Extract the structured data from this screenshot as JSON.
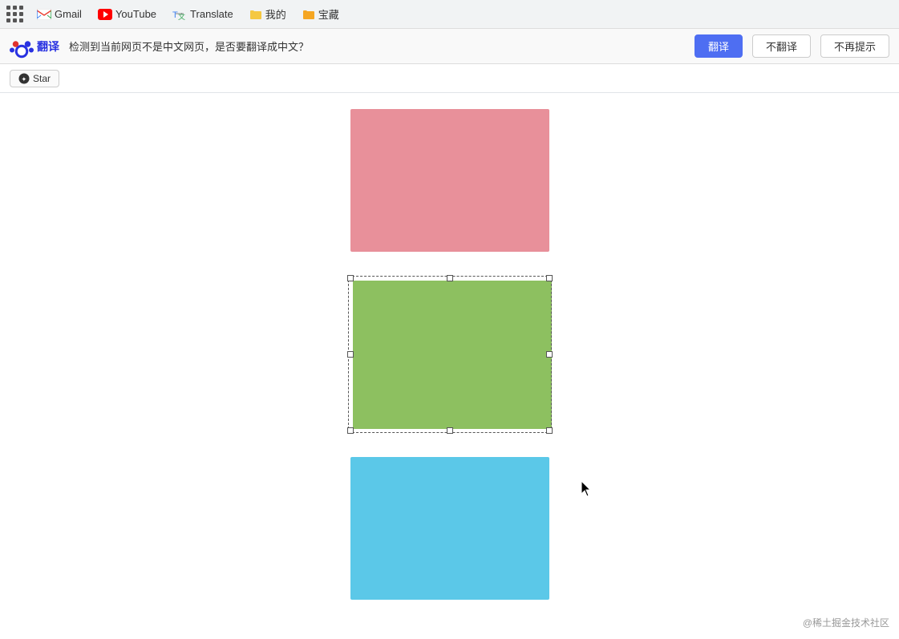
{
  "toolbar": {
    "apps_label": "应用",
    "gmail_label": "Gmail",
    "youtube_label": "YouTube",
    "translate_label": "Translate",
    "folder1_label": "我的",
    "folder2_label": "宝藏"
  },
  "baidu_bar": {
    "logo_text": "翻译",
    "message": "检测到当前网页不是中文网页，是否要翻译成中文？",
    "btn_translate": "翻译",
    "btn_no": "不翻译",
    "btn_never": "不再提示"
  },
  "star_bar": {
    "star_label": "Star"
  },
  "rectangles": {
    "pink_color": "#e8909a",
    "green_color": "#8dc060",
    "blue_color": "#5bc8e8"
  },
  "watermark": {
    "text": "@稀土掘金技术社区"
  }
}
